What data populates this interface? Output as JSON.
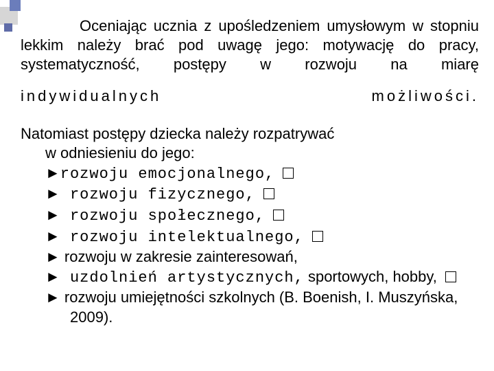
{
  "intro_text": "Oceniając ucznia z upośledzeniem umysłowym w stopniu lekkim należy brać pod uwagę jego: motywację do pracy, systematyczność, postępy w rozwoju na miarę",
  "spaced_text": "indywidualnych możliwości.",
  "lead": {
    "line1": "Natomiast postępy dziecka należy rozpatrywać",
    "line2": "w odniesieniu do jego:"
  },
  "bullets": {
    "b1_pre": "►",
    "b1_text": "rozwoju emocjonalnego,",
    "b2_pre": "►",
    "b2_text": " rozwoju fizycznego,",
    "b3_pre": "►",
    "b3_text": " rozwoju społecznego,",
    "b4_pre": "►",
    "b4_text": " rozwoju intelektualnego,",
    "b5_pre": "►",
    "b5_text": " rozwoju w zakresie zainteresowań,",
    "b6_pre": "►",
    "b6_text_a": " uzdolnień artystycznych,",
    "b6_text_b": " sportowych, hobby,",
    "b7_pre": "►",
    "b7_text": " rozwoju umiejętności szkolnych (B. Boenish, I. Muszyńska, 2009)."
  }
}
